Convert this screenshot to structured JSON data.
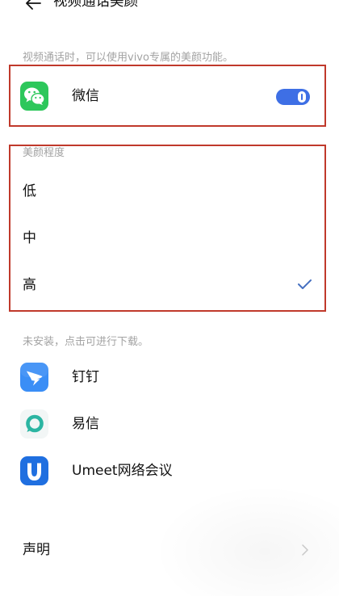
{
  "header": {
    "title": "视频通话美颜",
    "back_icon": "arrow-left-icon"
  },
  "beauty_intro": "视频通话时，可以使用vivo专属的美颜功能。",
  "installed_apps": [
    {
      "name": "微信",
      "icon": "wechat-icon",
      "beauty_enabled": true
    }
  ],
  "beauty_level": {
    "label": "美颜程度",
    "options": [
      {
        "label": "低",
        "selected": false
      },
      {
        "label": "中",
        "selected": false
      },
      {
        "label": "高",
        "selected": true
      }
    ],
    "selected_icon": "checkmark-icon"
  },
  "not_installed_hint": "未安装，点击可进行下载。",
  "downloadable_apps": [
    {
      "name": "钉钉",
      "icon": "dingtalk-icon"
    },
    {
      "name": "易信",
      "icon": "yixin-icon"
    },
    {
      "name": "Umeet网络会议",
      "icon": "umeet-icon",
      "logo_letter": "U"
    }
  ],
  "statement": {
    "label": "声明",
    "icon": "chevron-right-icon"
  },
  "colors": {
    "background": "#ffffff",
    "text": "#111111",
    "hint_text": "#a3a3a3",
    "accent": "#3e6fe5",
    "checkmark": "#4670c0",
    "chevron": "#c8c8c8",
    "highlight_border": "#c0392b",
    "wechat": "#2dc75b",
    "dingtalk": "#3a8ef6",
    "yixin": "#2bb5a2",
    "umeet": "#1f6fe0"
  }
}
